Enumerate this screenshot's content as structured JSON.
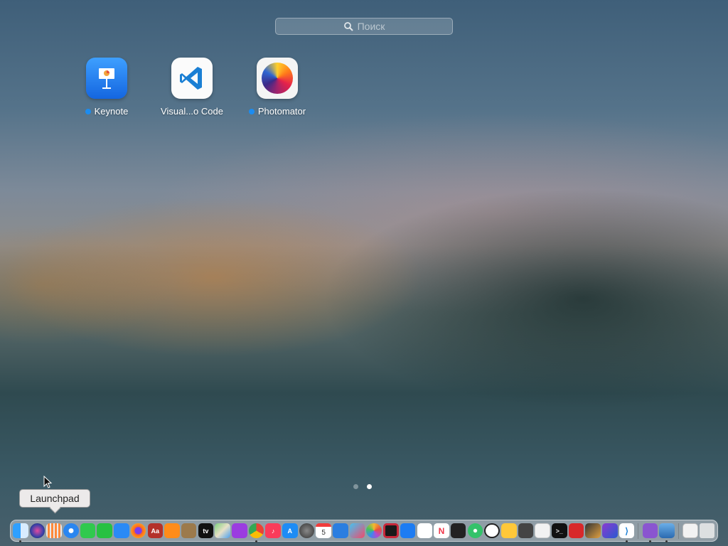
{
  "search": {
    "placeholder": "Поиск"
  },
  "apps": [
    {
      "name": "Keynote",
      "new_dot": true
    },
    {
      "name": "Visual...o Code",
      "new_dot": false
    },
    {
      "name": "Photomator",
      "new_dot": true
    }
  ],
  "tooltip": {
    "text": "Launchpad"
  },
  "pager": {
    "pages": 2,
    "current": 2
  },
  "calendar": {
    "day": "5"
  },
  "colors": {
    "new_dot": "#1c8cf0",
    "keynote_blue": "#1d7cf2",
    "vscode_blue": "#1a7fd4"
  },
  "dock_items": [
    "finder-icon",
    "siri-icon",
    "launchpad-icon",
    "safari-icon",
    "messages-icon",
    "facetime-icon",
    "mail-icon",
    "firefox-icon",
    "dictionary-icon",
    "books-icon",
    "notes-brown-icon",
    "appletv-icon",
    "maps-icon",
    "podcasts-icon",
    "chrome-icon",
    "music-icon",
    "appstore-icon",
    "system-settings-icon",
    "calendar-icon",
    "icloud-icon",
    "screens-icon",
    "photos-icon",
    "capture-icon",
    "keynote-icon",
    "reminders-icon",
    "news-icon",
    "activity-monitor-icon",
    "find-my-icon",
    "clock-icon",
    "home-icon",
    "calculator-icon",
    "textedit-icon",
    "terminal-icon",
    "toolbox-icon",
    "brush-icon",
    "affinity-icon",
    "vscode-icon",
    "visual-studio-icon",
    "preview-icon",
    "downloads-icon",
    "trash-icon"
  ]
}
